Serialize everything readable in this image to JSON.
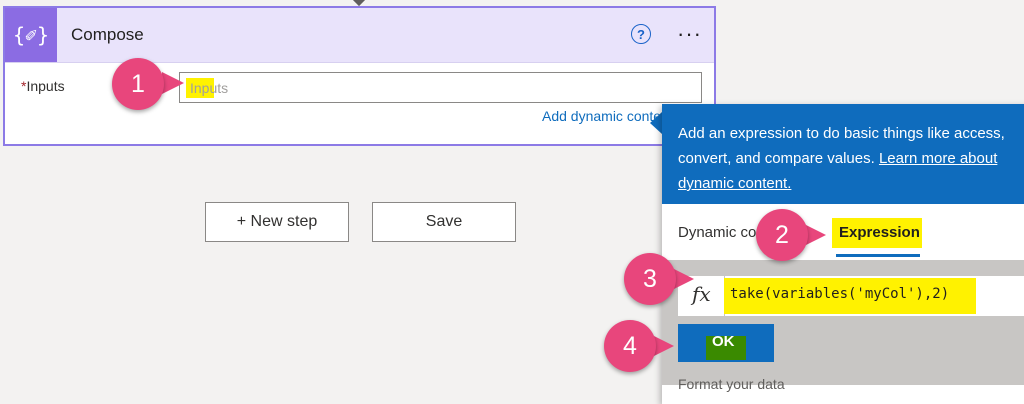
{
  "compose": {
    "title": "Compose",
    "icon": "code-braces-pencil-icon",
    "icon_glyph": "{✐}",
    "help_glyph": "?",
    "more_glyph": "···",
    "inputs_label": "Inputs",
    "required_mark": "*",
    "inputs_placeholder": "Inputs",
    "add_dynamic_label": "Add dynamic content"
  },
  "actions": {
    "new_step_label": "+ New step",
    "save_label": "Save"
  },
  "panel": {
    "info_line1": "Add an expression to do basic things like access,",
    "info_line2_text": "convert, and compare values. ",
    "info_line2_link": "Learn more about",
    "info_line3_link": "dynamic content.",
    "tab_dynamic_label": "Dynamic content",
    "tab_expression_label": "Expression",
    "fx_glyph": "fx",
    "expression_value": "take(variables('myCol'),2)",
    "ok_label": "OK",
    "format_label": "Format your data"
  },
  "callouts": [
    "1",
    "2",
    "3",
    "4"
  ],
  "colors": {
    "accent_purple": "#8b6ce3",
    "header_bg": "#e9e3fb",
    "brand_blue": "#0f6cbd",
    "highlight_yellow": "#fff200",
    "callout_pink": "#e8467c"
  }
}
